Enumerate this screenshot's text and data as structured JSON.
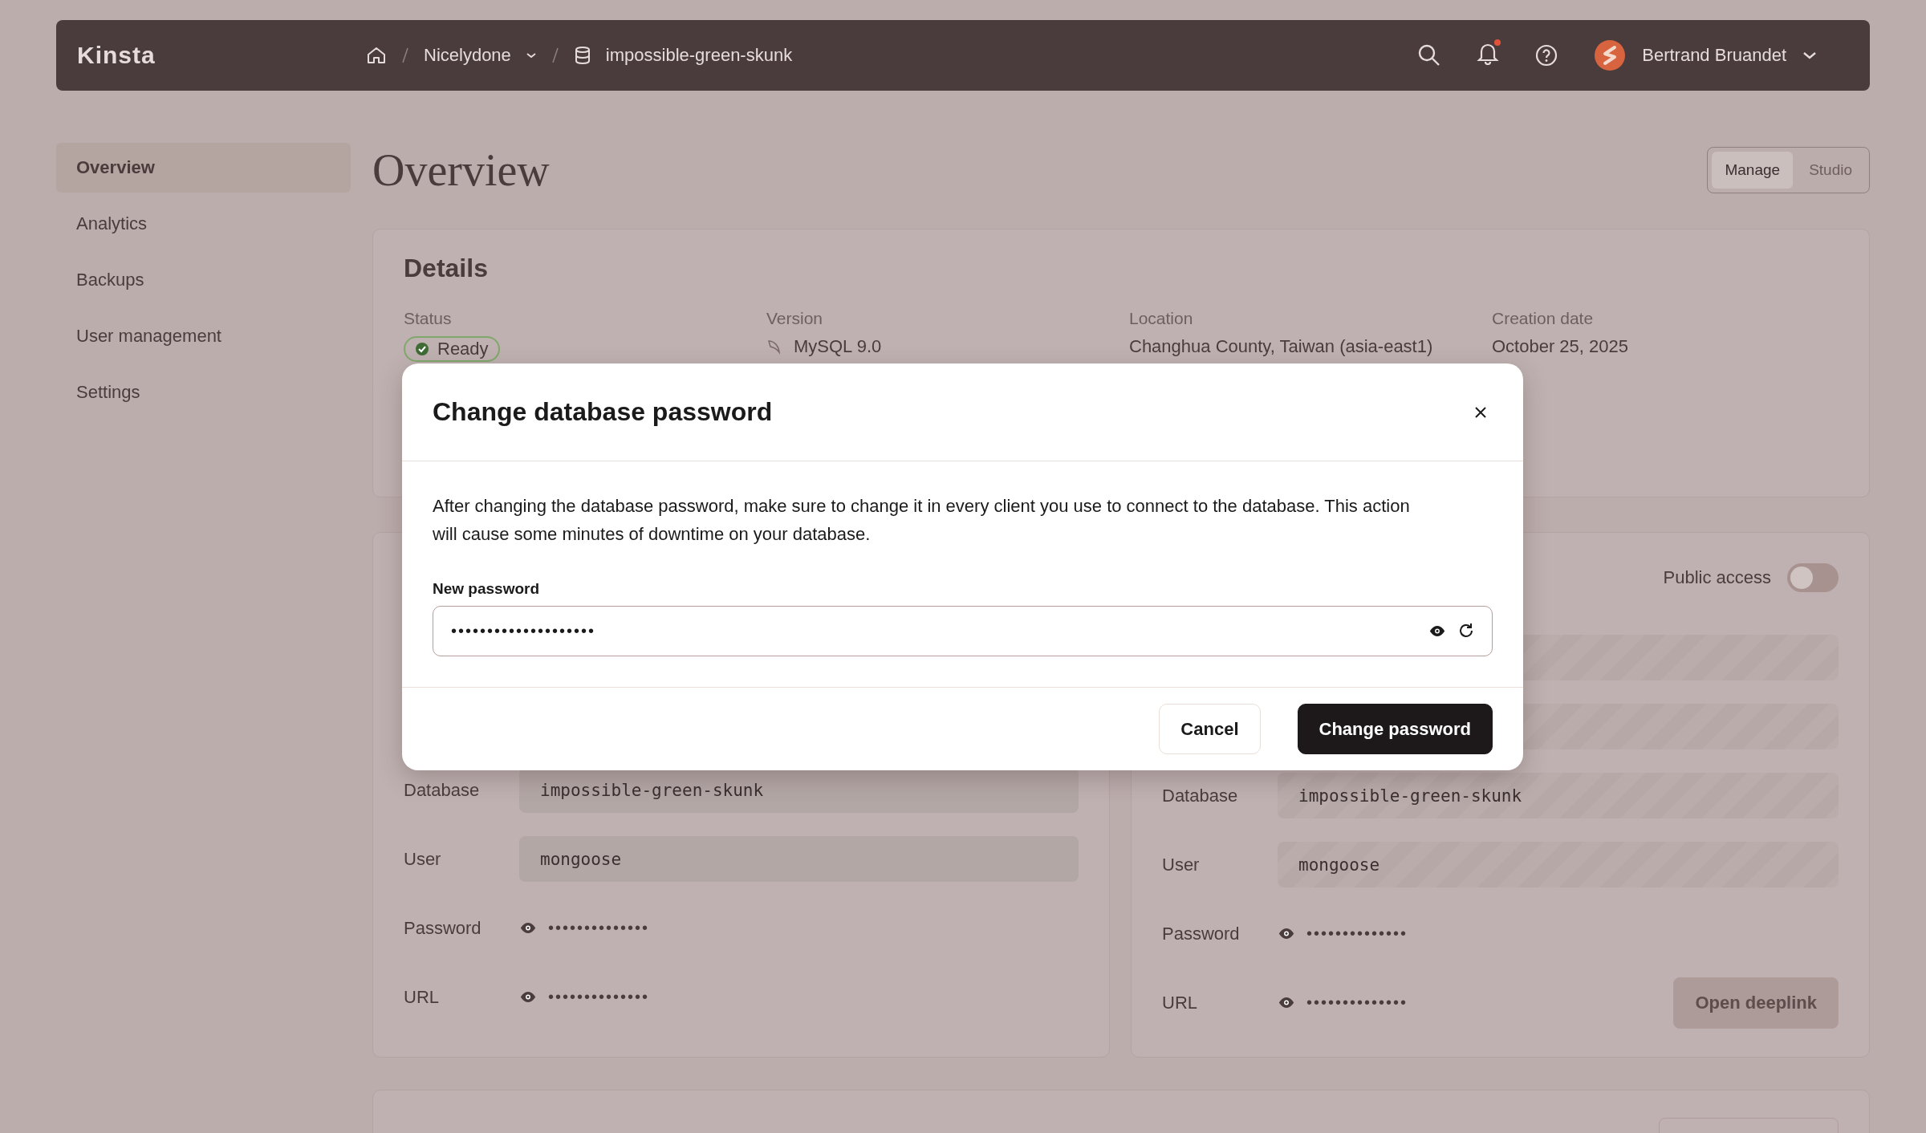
{
  "topbar": {
    "logo": "Kinsta",
    "breadcrumbs": [
      {
        "label": "Nicelydone",
        "kind": "company"
      },
      {
        "label": "impossible-green-skunk",
        "kind": "database"
      }
    ],
    "notifications": {
      "unread": true
    },
    "user": {
      "name": "Bertrand Bruandet"
    }
  },
  "sidebar": {
    "items": [
      {
        "label": "Overview",
        "selected": true
      },
      {
        "label": "Analytics",
        "selected": false
      },
      {
        "label": "Backups",
        "selected": false
      },
      {
        "label": "User management",
        "selected": false
      },
      {
        "label": "Settings",
        "selected": false
      }
    ]
  },
  "page": {
    "title": "Overview",
    "view_toggle": [
      {
        "label": "Manage",
        "selected": true
      },
      {
        "label": "Studio",
        "selected": false
      }
    ]
  },
  "details": {
    "title": "Details",
    "fields": [
      {
        "label": "Status",
        "value": "Ready",
        "kind": "status"
      },
      {
        "label": "Version",
        "value": "MySQL 9.0",
        "kind": "version"
      },
      {
        "label": "Location",
        "value": "Changhua County, Taiwan (asia-east1)",
        "kind": "text"
      },
      {
        "label": "Creation date",
        "value": "October 25, 2025",
        "kind": "text"
      }
    ]
  },
  "left_panel": {
    "rows": [
      {
        "label": "Database",
        "value": "impossible-green-skunk",
        "kind": "field"
      },
      {
        "label": "User",
        "value": "mongoose",
        "kind": "field"
      },
      {
        "label": "Password",
        "value": "••••••••••••••",
        "kind": "secret"
      },
      {
        "label": "URL",
        "value": "••••••••••••••",
        "kind": "secret"
      }
    ]
  },
  "right_panel": {
    "public_access": {
      "label": "Public access",
      "on": false
    },
    "rows": [
      {
        "kind": "field"
      },
      {
        "kind": "field"
      },
      {
        "label": "Database",
        "value": "impossible-green-skunk",
        "kind": "field"
      },
      {
        "label": "User",
        "value": "mongoose",
        "kind": "field"
      },
      {
        "label": "Password",
        "value": "••••••••••••••",
        "kind": "secret"
      },
      {
        "label": "URL",
        "value": "••••••••••••••",
        "kind": "secret"
      }
    ],
    "action": {
      "label": "Open deeplink",
      "disabled": true
    }
  },
  "modal": {
    "title": "Change database password",
    "message": "After changing the database password, make sure to change it in every client you use to connect to the database. This action will cause some minutes of downtime on your database.",
    "field": {
      "label": "New password",
      "value": "••••••••••••••••••••"
    },
    "buttons": [
      {
        "label": "Cancel",
        "kind": "secondary"
      },
      {
        "label": "Change password",
        "kind": "primary"
      }
    ]
  }
}
